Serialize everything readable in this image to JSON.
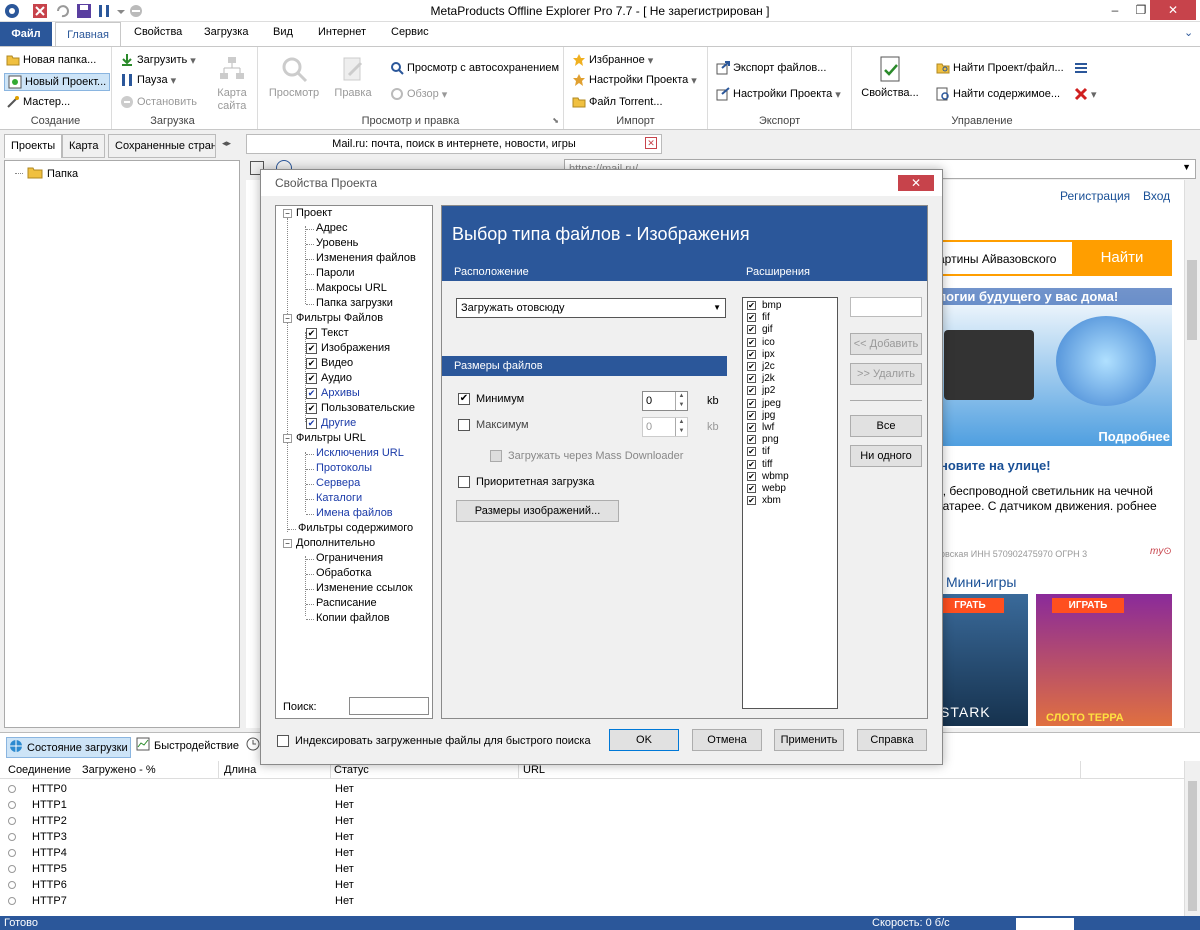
{
  "app": {
    "title": "MetaProducts Offline Explorer Pro 7.7 - [ Не зарегистрирован ]",
    "menu_tabs": [
      "Файл",
      "Главная",
      "Свойства",
      "Загрузка",
      "Вид",
      "Интернет",
      "Сервис"
    ]
  },
  "ribbon": {
    "create": {
      "label": "Создание",
      "new_folder": "Новая папка...",
      "new_project": "Новый Проект...",
      "wizard": "Мастер..."
    },
    "download": {
      "label": "Загрузка",
      "download": "Загрузить",
      "pause": "Пауза",
      "stop": "Остановить",
      "site_map": "Карта сайта"
    },
    "view": {
      "label": "Просмотр и правка",
      "view": "Просмотр",
      "edit": "Правка",
      "autosave_view": "Просмотр с автосохранением",
      "browse": "Обзор"
    },
    "import": {
      "label": "Импорт",
      "favorites": "Избранное",
      "project_settings": "Настройки Проекта",
      "torrent": "Файл Torrent..."
    },
    "export": {
      "label": "Экспорт",
      "export_files": "Экспорт файлов...",
      "project_settings": "Настройки Проекта"
    },
    "manage": {
      "label": "Управление",
      "properties": "Свойства...",
      "find_project": "Найти Проект/файл...",
      "find_content": "Найти содержимое..."
    }
  },
  "left_panel": {
    "tabs": [
      "Проекты",
      "Карта",
      "Сохраненные страни"
    ],
    "tree_item": "Папка"
  },
  "browser": {
    "doc_tab": "Mail.ru: почта, поиск в интернете, новости, игры",
    "address": "https://mail.ru/",
    "page": {
      "register": "Регистрация",
      "login": "Вход",
      "search_query": "артины Айвазовского",
      "search_button": "Найти",
      "ad_headline": "логии будущего у вас дома!",
      "ad_more": "Подробнее",
      "ad_title": "новите на улице!",
      "ad_text": "й, беспроводной светильник на чечной батарее. С датчиком движения. робнее",
      "ad_legal": "ковская ИНН 570902475970 ОГРН 3",
      "mini_games": "Мини-игры",
      "play1": "ГРАТЬ",
      "play2": "ИГРАТЬ",
      "game1_caption": "STARK",
      "game2_caption": "СЛОТО ТЕРРА"
    }
  },
  "bottom": {
    "tabs": [
      "Состояние загрузки",
      "Быстродействие"
    ],
    "columns": [
      "Соединение",
      "Загружено - %",
      "Длина",
      "Статус",
      "URL"
    ],
    "rows": [
      {
        "conn": "HTTP0",
        "status": "Нет"
      },
      {
        "conn": "HTTP1",
        "status": "Нет"
      },
      {
        "conn": "HTTP2",
        "status": "Нет"
      },
      {
        "conn": "HTTP3",
        "status": "Нет"
      },
      {
        "conn": "HTTP4",
        "status": "Нет"
      },
      {
        "conn": "HTTP5",
        "status": "Нет"
      },
      {
        "conn": "HTTP6",
        "status": "Нет"
      },
      {
        "conn": "HTTP7",
        "status": "Нет"
      }
    ]
  },
  "status": {
    "left": "Готово",
    "speed": "Скорость: 0 б/с"
  },
  "dialog": {
    "title": "Свойства Проекта",
    "header": "Выбор типа файлов - Изображения",
    "location_label": "Расположение",
    "extensions_label": "Расширения",
    "location_value": "Загружать отовсюду",
    "sizes_label": "Размеры файлов",
    "min_label": "Минимум",
    "min_value": "0",
    "min_unit": "kb",
    "max_label": "Максимум",
    "max_value": "0",
    "max_unit": "kb",
    "mass_label": "Загружать через Mass Downloader",
    "priority_label": "Приоритетная загрузка",
    "image_sizes_btn": "Размеры изображений...",
    "add_btn": "<< Добавить",
    "remove_btn": ">> Удалить",
    "all_btn": "Все",
    "none_btn": "Ни одного",
    "extensions": [
      "bmp",
      "fif",
      "gif",
      "ico",
      "ipx",
      "j2c",
      "j2k",
      "jp2",
      "jpeg",
      "jpg",
      "lwf",
      "png",
      "tif",
      "tiff",
      "wbmp",
      "webp",
      "xbm"
    ],
    "search_label": "Поиск:",
    "index_label": "Индексировать загруженные файлы для быстрого поиска",
    "ok": "OK",
    "cancel": "Отмена",
    "apply": "Применить",
    "help": "Справка",
    "tree": {
      "project": "Проект",
      "project_children": [
        "Адрес",
        "Уровень",
        "Изменения файлов",
        "Пароли",
        "Макросы URL",
        "Папка загрузки"
      ],
      "file_filters": "Фильтры Файлов",
      "file_filter_children": [
        "Текст",
        "Изображения",
        "Видео",
        "Аудио",
        "Архивы",
        "Пользовательские",
        "Другие"
      ],
      "url_filters": "Фильтры URL",
      "url_filter_children": [
        "Исключения URL",
        "Протоколы",
        "Сервера",
        "Каталоги",
        "Имена файлов"
      ],
      "content_filters": "Фильтры содержимого",
      "advanced": "Дополнительно",
      "advanced_children": [
        "Ограничения",
        "Обработка",
        "Изменение ссылок",
        "Расписание",
        "Копии файлов"
      ]
    }
  }
}
